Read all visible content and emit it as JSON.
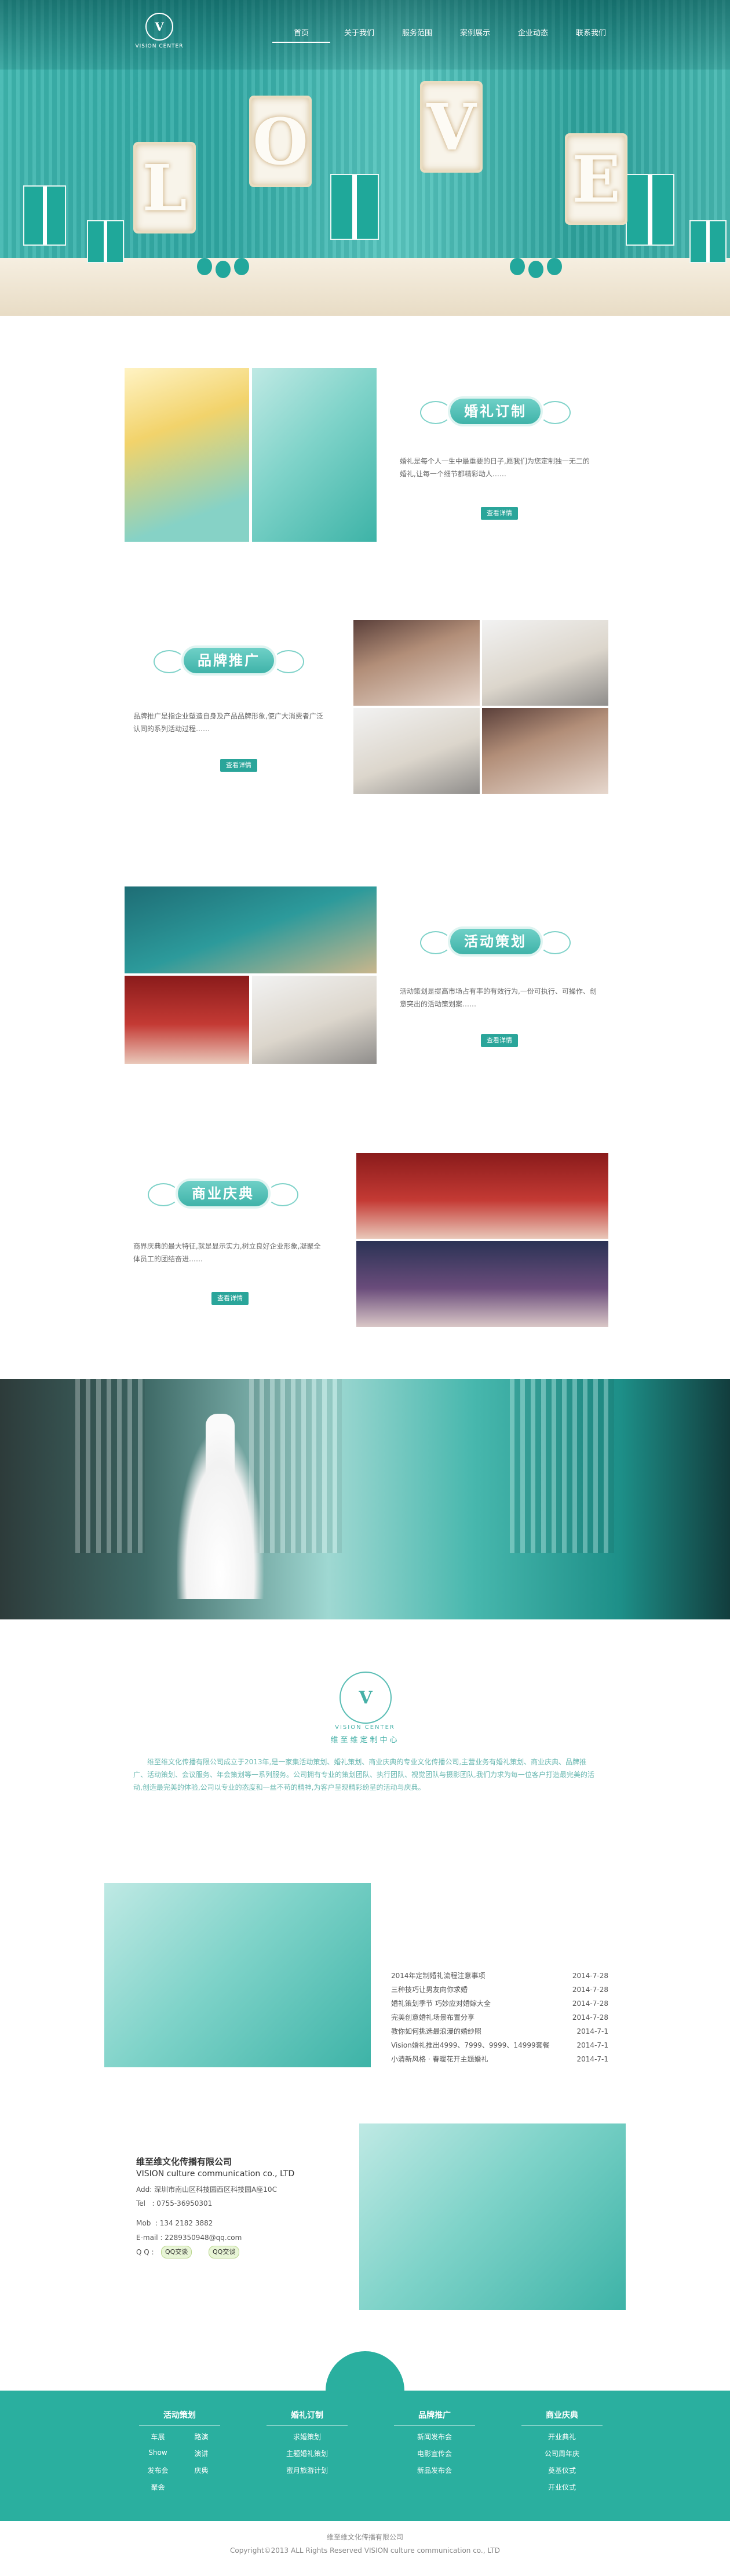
{
  "brand": {
    "logo_text": "VISION CENTER",
    "logo_monogram": "V"
  },
  "nav": {
    "items": [
      {
        "label": "首页"
      },
      {
        "label": "关于我们"
      },
      {
        "label": "服务范围"
      },
      {
        "label": "案例展示"
      },
      {
        "label": "企业动态"
      },
      {
        "label": "联系我们"
      }
    ]
  },
  "hero": {
    "letters": [
      "L",
      "O",
      "V",
      "E"
    ]
  },
  "sections": [
    {
      "title": "婚礼订制",
      "desc": "婚礼是每个人一生中最重要的日子,愿我们为您定制独一无二的婚礼,让每一个细节都精彩动人……",
      "more": "查看详情"
    },
    {
      "title": "品牌推广",
      "desc": "品牌推广是指企业塑造自身及产品品牌形象,使广大消费者广泛认同的系列活动过程……",
      "more": "查看详情"
    },
    {
      "title": "活动策划",
      "desc": "活动策划是提高市场占有率的有效行为,一份可执行、可操作、创意突出的活动策划案……",
      "more": "查看详情"
    },
    {
      "title": "商业庆典",
      "desc": "商界庆典的最大特征,就是显示实力,树立良好企业形象,凝聚全体员工的团结奋进……",
      "more": "查看详情"
    }
  ],
  "about": {
    "logo_text": "VISION CENTER",
    "title": "维至维定制中心",
    "text": "维至维文化传播有限公司成立于2013年,是一家集活动策划、婚礼策划、商业庆典的专业文化传播公司,主营业务有婚礼策划、商业庆典、品牌推广、活动策划、会议服务、年会策划等一系列服务。公司拥有专业的策划团队、执行团队、视觉团队与摄影团队,我们力求为每一位客户打造最完美的活动,创造最完美的体验,公司以专业的态度和一丝不苟的精神,为客户呈现精彩纷呈的活动与庆典。"
  },
  "news": [
    {
      "title": "2014年定制婚礼流程注意事项",
      "date": "2014-7-28"
    },
    {
      "title": "三种技巧让男友向你求婚",
      "date": "2014-7-28"
    },
    {
      "title": "婚礼策划季节 巧妙应对婚嫁大全",
      "date": "2014-7-28"
    },
    {
      "title": "完美创意婚礼场景布置分享",
      "date": "2014-7-28"
    },
    {
      "title": "教你如何挑选最浪漫的婚纱照",
      "date": "2014-7-1"
    },
    {
      "title": "Vision婚礼推出4999、7999、9999、14999套餐",
      "date": "2014-7-1"
    },
    {
      "title": "小清新风格 · 春暖花开主题婚礼",
      "date": "2014-7-1"
    }
  ],
  "contact": {
    "company_cn": "维至维文化传播有限公司",
    "company_en": "VISION culture communication co., LTD",
    "address": "Add: 深圳市南山区科技园西区科技园A座10C",
    "phone": "Tel   : 0755-36950301",
    "mobile": "Mob  : 134 2182 3882",
    "email": "E-mail : 2289350948@qq.com",
    "qq_label": "Q Q :",
    "qq_buttons": [
      "QQ交谈",
      "QQ交谈"
    ]
  },
  "footer": {
    "columns": [
      {
        "title": "活动策划",
        "items": [
          "车展",
          "路演",
          "Show",
          "演讲",
          "发布会",
          "庆典",
          "聚会"
        ]
      },
      {
        "title": "婚礼订制",
        "items": [
          "求婚策划",
          "主题婚礼策划",
          "蜜月旅游计划"
        ]
      },
      {
        "title": "品牌推广",
        "items": [
          "新闻发布会",
          "电影宣传会",
          "新品发布会"
        ]
      },
      {
        "title": "商业庆典",
        "items": [
          "开业典礼",
          "公司周年庆",
          "奠基仪式",
          "开业仪式"
        ]
      }
    ],
    "copyright_cn": "维至维文化传播有限公司",
    "copyright_en": "Copyright©2013 ALL Rights Reserved VISION culture communication co., LTD"
  },
  "colors": {
    "accent": "#2aaf9f",
    "accent_light": "#6fd0c7",
    "text": "#555555"
  }
}
